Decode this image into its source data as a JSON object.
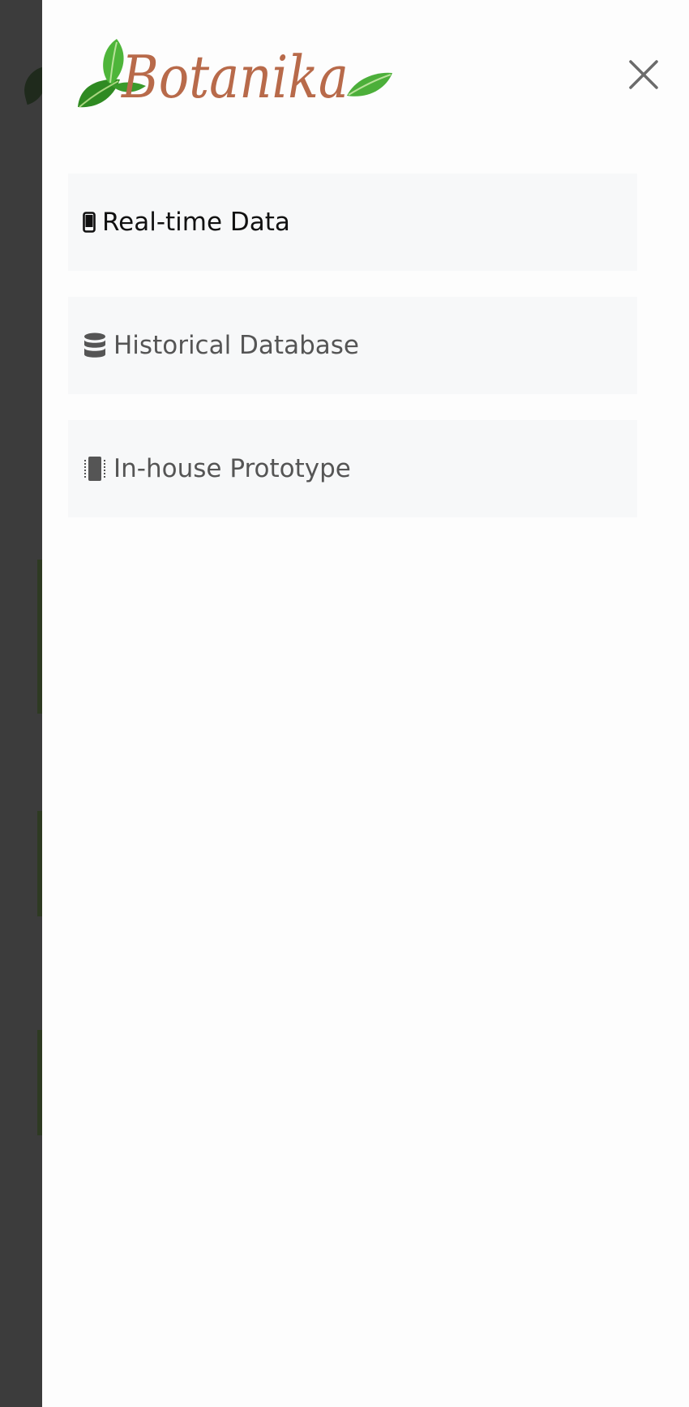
{
  "backdrop": {},
  "drawer": {
    "logo": {
      "text": "Botanika",
      "text_color": "#b86a4a",
      "leaf_color": "#3f9b2f"
    },
    "close_icon": "close-icon"
  },
  "nav": {
    "items": [
      {
        "label": "Real-time Data",
        "icon": "mobile-phone-icon",
        "active": true
      },
      {
        "label": "Historical Database",
        "icon": "database-icon",
        "active": false
      },
      {
        "label": "In-house Prototype",
        "icon": "device-vibrate-icon",
        "active": false
      }
    ]
  },
  "colors": {
    "active_text": "#111111",
    "inactive_text": "#555555",
    "item_background": "#f7f8f9",
    "backdrop": "#3c3c3c"
  }
}
